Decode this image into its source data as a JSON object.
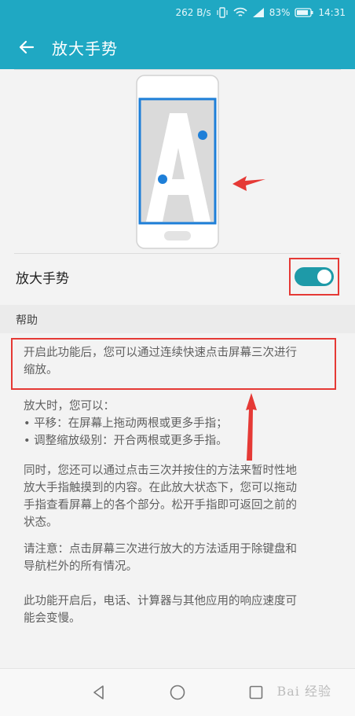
{
  "status_bar": {
    "speed": "262 B/s",
    "battery": "83%",
    "time": "14:31"
  },
  "app_bar": {
    "title": "放大手势"
  },
  "toggle": {
    "label": "放大手势",
    "enabled": true
  },
  "section": {
    "header": "帮助"
  },
  "help": {
    "p1_line1": "开启此功能后，您可以通过连续快速点击屏幕三次进行",
    "p1_line2": "缩放。",
    "p2_line1": "放大时，您可以：",
    "p2_line2": "• 平移：在屏幕上拖动两根或更多手指；",
    "p2_line3": "• 调整缩放级别：开合两根或更多手指。",
    "p3_line1": "同时，您还可以通过点击三次并按住的方法来暂时性地",
    "p3_line2": "放大手指触摸到的内容。在此放大状态下，您可以拖动",
    "p3_line3": "手指查看屏幕上的各个部分。松开手指即可返回之前的",
    "p3_line4": "状态。",
    "p4_line1": "请注意：点击屏幕三次进行放大的方法适用于除键盘和",
    "p4_line2": "导航栏外的所有情况。",
    "p5_line1": "此功能开启后，电话、计算器与其他应用的响应速度可",
    "p5_line2": "能会变慢。"
  },
  "watermark": "Bai 经验",
  "colors": {
    "accent": "#1fa8c3",
    "annotation": "#e53935",
    "switch_on": "#1e9aa8"
  }
}
